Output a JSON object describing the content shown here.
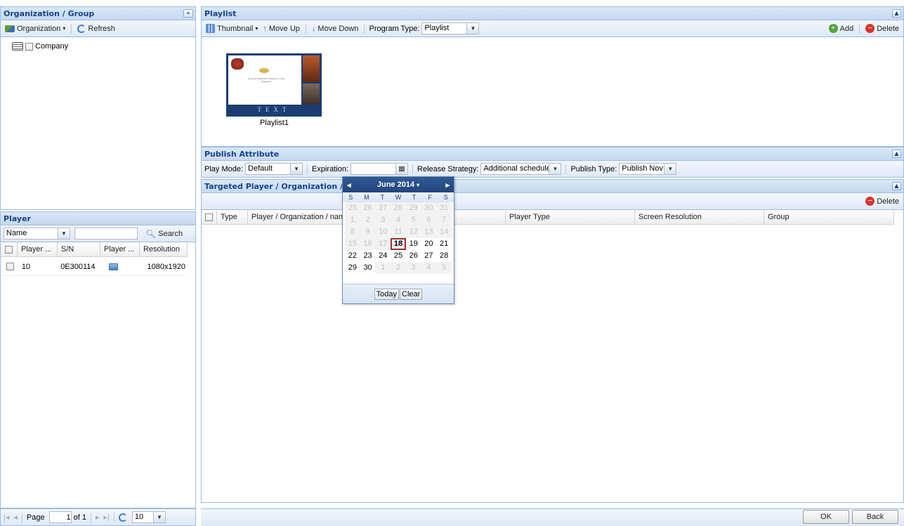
{
  "org_panel": {
    "title": "Organization / Group",
    "collapse_glyph": "«",
    "organization_btn": "Organization",
    "refresh_btn": "Refresh",
    "tree": [
      {
        "label": "Company",
        "icon": "group-icon"
      }
    ]
  },
  "player_panel": {
    "title": "Player",
    "search_field": "Name",
    "search_value": "",
    "search_btn": "Search",
    "columns": [
      "Player ...",
      "S/N",
      "Player ...",
      "Resolution"
    ],
    "rows": [
      {
        "name": "10",
        "sn": "0E300114",
        "type_icon": "monitor-icon",
        "resolution": "1080x1920"
      }
    ],
    "pager": {
      "page_label": "Page",
      "page_value": "1",
      "of_label": "of 1",
      "page_size": "10"
    }
  },
  "playlist_panel": {
    "title": "Playlist",
    "thumbnail_btn": "Thumbnail",
    "move_up_btn": "Move Up",
    "move_down_btn": "Move Down",
    "program_type_label": "Program Type:",
    "program_type_value": "Playlist",
    "add_btn": "Add",
    "delete_btn": "Delete",
    "items": [
      {
        "label": "Playlist1",
        "thumb_text": "TEXT",
        "thumb_caption": "Got good feeling can change your body language?"
      }
    ]
  },
  "publish_panel": {
    "title": "Publish Attribute",
    "play_mode_label": "Play Mode:",
    "play_mode_value": "Default",
    "expiration_label": "Expiration:",
    "expiration_value": "",
    "release_label": "Release Strategy:",
    "release_value": "Additional schedule",
    "publish_type_label": "Publish Type:",
    "publish_type_value": "Publish Nov"
  },
  "target_panel": {
    "title": "Targeted Player / Organization / Gr",
    "delete_btn": "Delete",
    "columns": [
      "Type",
      "Player / Organization / nam",
      "Player Type",
      "Screen Resolution",
      "Group"
    ]
  },
  "calendar": {
    "month_label": "June 2014",
    "dow": [
      "S",
      "M",
      "T",
      "W",
      "T",
      "F",
      "S"
    ],
    "weeks": [
      [
        [
          "25",
          "dis"
        ],
        [
          "26",
          "dis"
        ],
        [
          "27",
          "dis"
        ],
        [
          "28",
          "dis"
        ],
        [
          "29",
          "dis"
        ],
        [
          "30",
          "dis"
        ],
        [
          "31",
          "dis"
        ]
      ],
      [
        [
          "1",
          "dis"
        ],
        [
          "2",
          "dis"
        ],
        [
          "3",
          "dis"
        ],
        [
          "4",
          "dis"
        ],
        [
          "5",
          "dis"
        ],
        [
          "6",
          "dis"
        ],
        [
          "7",
          "dis"
        ]
      ],
      [
        [
          "8",
          "dis"
        ],
        [
          "9",
          "dis"
        ],
        [
          "10",
          "dis"
        ],
        [
          "11",
          "dis"
        ],
        [
          "12",
          "dis"
        ],
        [
          "13",
          "dis"
        ],
        [
          "14",
          "dis"
        ]
      ],
      [
        [
          "15",
          "dis"
        ],
        [
          "16",
          "dis"
        ],
        [
          "17",
          "dis"
        ],
        [
          "18",
          "today"
        ],
        [
          "19",
          "act"
        ],
        [
          "20",
          "act"
        ],
        [
          "21",
          "act"
        ]
      ],
      [
        [
          "22",
          "act"
        ],
        [
          "23",
          "act"
        ],
        [
          "24",
          "act"
        ],
        [
          "25",
          "act"
        ],
        [
          "26",
          "act"
        ],
        [
          "27",
          "act"
        ],
        [
          "28",
          "act"
        ]
      ],
      [
        [
          "29",
          "act"
        ],
        [
          "30",
          "act"
        ],
        [
          "1",
          "dis"
        ],
        [
          "2",
          "dis"
        ],
        [
          "3",
          "dis"
        ],
        [
          "4",
          "dis"
        ],
        [
          "5",
          "dis"
        ]
      ]
    ],
    "today_btn": "Today",
    "clear_btn": "Clear"
  },
  "footer": {
    "ok_btn": "OK",
    "back_btn": "Back"
  }
}
